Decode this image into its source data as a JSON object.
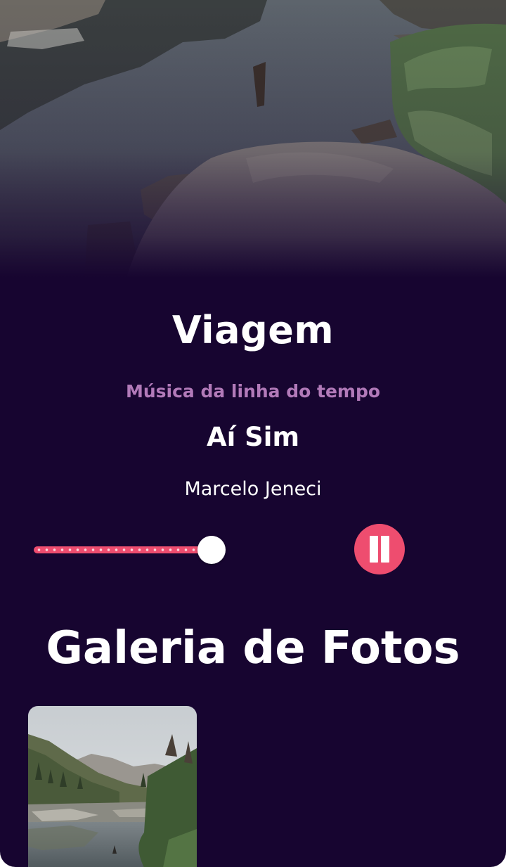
{
  "trip": {
    "title": "Viagem"
  },
  "music": {
    "section_label": "Música da linha do tempo",
    "song_title": "Aí Sim",
    "artist": "Marcelo Jeneci",
    "progress_fraction": 0.93,
    "state": "playing",
    "control_icon": "pause-icon"
  },
  "gallery": {
    "title": "Galeria de Fotos",
    "photos": [
      {
        "icon": "mountain-lake-photo"
      }
    ]
  },
  "colors": {
    "background": "#170530",
    "accent": "#ee4d6f",
    "subtitle": "#b27ab9",
    "text": "#ffffff"
  }
}
